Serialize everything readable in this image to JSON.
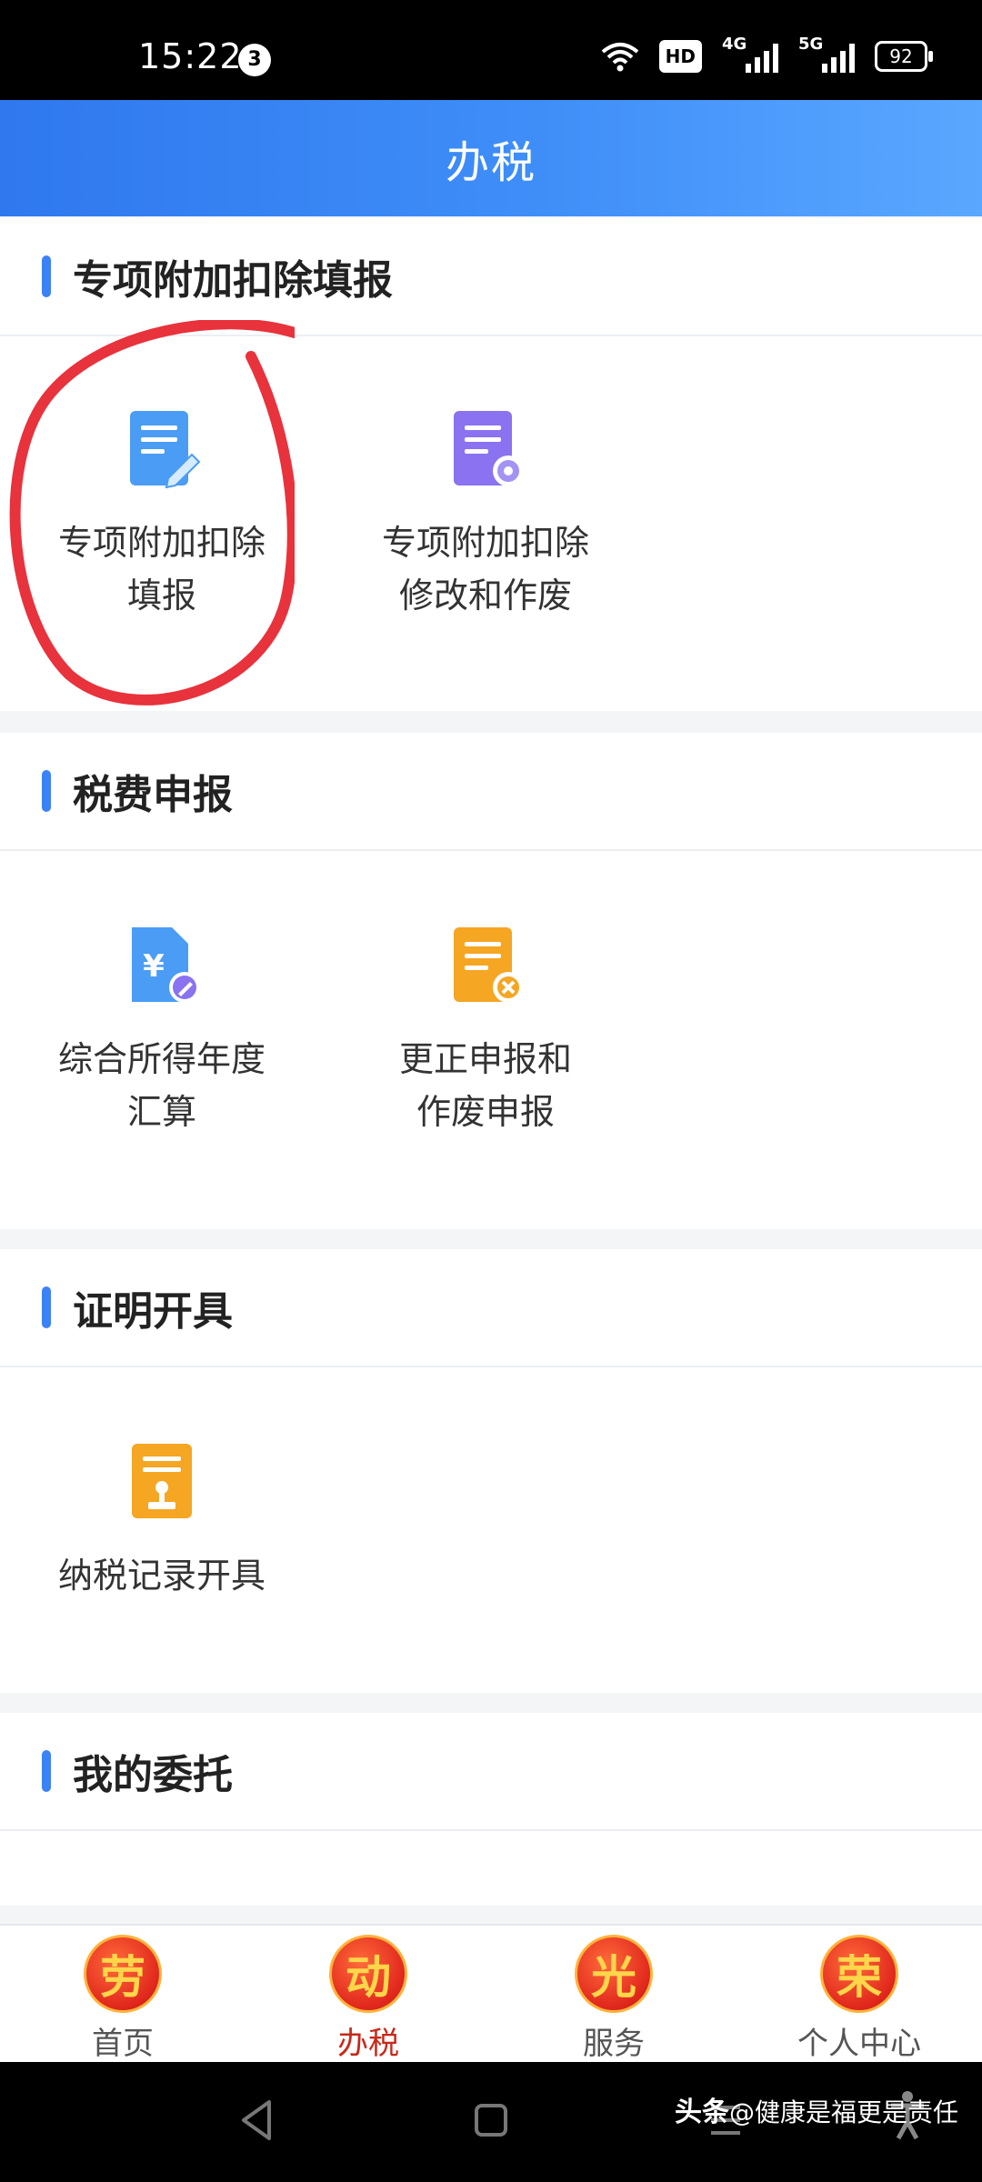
{
  "status_bar": {
    "time": "15:22",
    "notification_count": "3",
    "hd": "HD",
    "sig1": "4G",
    "sig2": "5G",
    "battery": "92"
  },
  "header": {
    "title": "办税"
  },
  "sections": [
    {
      "title": "专项附加扣除填报",
      "items": [
        {
          "line1": "专项附加扣除",
          "line2": "填报",
          "icon": "edit-document-icon"
        },
        {
          "line1": "专项附加扣除",
          "line2": "修改和作废",
          "icon": "settings-document-icon"
        }
      ]
    },
    {
      "title": "税费申报",
      "items": [
        {
          "line1": "综合所得年度",
          "line2": "汇算",
          "icon": "yuan-document-icon"
        },
        {
          "line1": "更正申报和",
          "line2": "作废申报",
          "icon": "cancel-document-icon"
        }
      ]
    },
    {
      "title": "证明开具",
      "items": [
        {
          "line1": "纳税记录开具",
          "line2": "",
          "icon": "stamp-document-icon"
        }
      ]
    },
    {
      "title": "我的委托",
      "items": []
    }
  ],
  "bottom_nav": [
    {
      "badge": "劳",
      "label": "首页",
      "active": false
    },
    {
      "badge": "动",
      "label": "办税",
      "active": true
    },
    {
      "badge": "光",
      "label": "服务",
      "active": false
    },
    {
      "badge": "荣",
      "label": "个人中心",
      "active": false
    }
  ],
  "watermark": {
    "brand": "头条",
    "text": "@健康是福更是责任"
  },
  "colors": {
    "accent": "#3b82f6",
    "header_start": "#2f78ee",
    "header_end": "#5aa7ff",
    "annotation_red": "#e8323c",
    "nav_active": "#c8281a"
  }
}
